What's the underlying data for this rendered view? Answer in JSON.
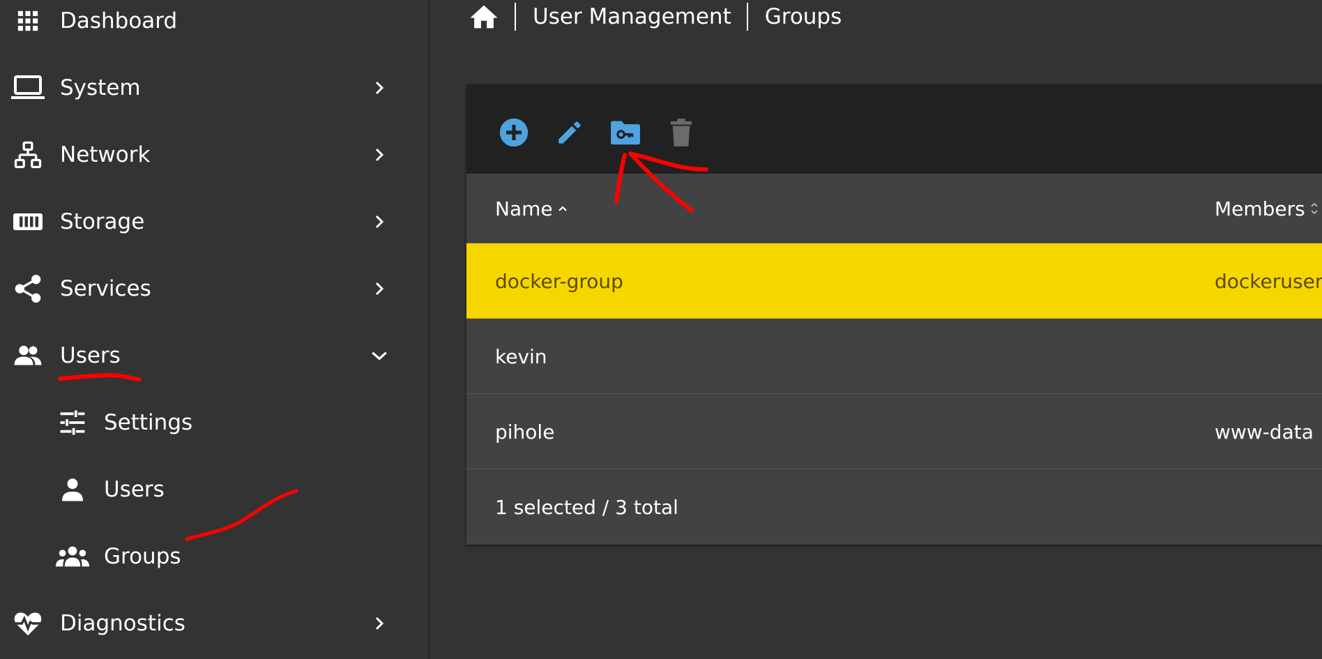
{
  "sidebar": {
    "items": [
      {
        "label": "Dashboard",
        "icon": "grid-icon"
      },
      {
        "label": "System",
        "icon": "laptop-icon"
      },
      {
        "label": "Network",
        "icon": "network-icon"
      },
      {
        "label": "Storage",
        "icon": "storage-icon"
      },
      {
        "label": "Services",
        "icon": "share-icon"
      },
      {
        "label": "Users",
        "icon": "users-icon",
        "expanded": true
      },
      {
        "label": "Diagnostics",
        "icon": "heartbeat-icon"
      }
    ],
    "users_submenu": [
      {
        "label": "Settings",
        "icon": "sliders-icon"
      },
      {
        "label": "Users",
        "icon": "user-icon"
      },
      {
        "label": "Groups",
        "icon": "groups-icon"
      }
    ]
  },
  "breadcrumb": {
    "items": [
      "User Management",
      "Groups"
    ]
  },
  "toolbar": {
    "buttons": [
      {
        "icon": "add-circle-icon",
        "color": "#4fa3e0"
      },
      {
        "icon": "pencil-icon",
        "color": "#4fa3e0"
      },
      {
        "icon": "folder-key-icon",
        "color": "#4fa3e0"
      },
      {
        "icon": "trash-icon",
        "color": "#6b6b6b",
        "disabled": true
      }
    ]
  },
  "table": {
    "columns": [
      "Name",
      "Members"
    ],
    "rows": [
      {
        "name": "docker-group",
        "members": "dockeruser,",
        "selected": true
      },
      {
        "name": "kevin",
        "members": "",
        "selected": false
      },
      {
        "name": "pihole",
        "members": "www-data",
        "selected": false
      }
    ],
    "footer": "1 selected / 3 total"
  },
  "colors": {
    "background": "#333333",
    "card": "#424242",
    "toolbar": "#212121",
    "selected_row": "#f7d600",
    "accent": "#4fa3e0",
    "annotation": "#ff0000"
  }
}
